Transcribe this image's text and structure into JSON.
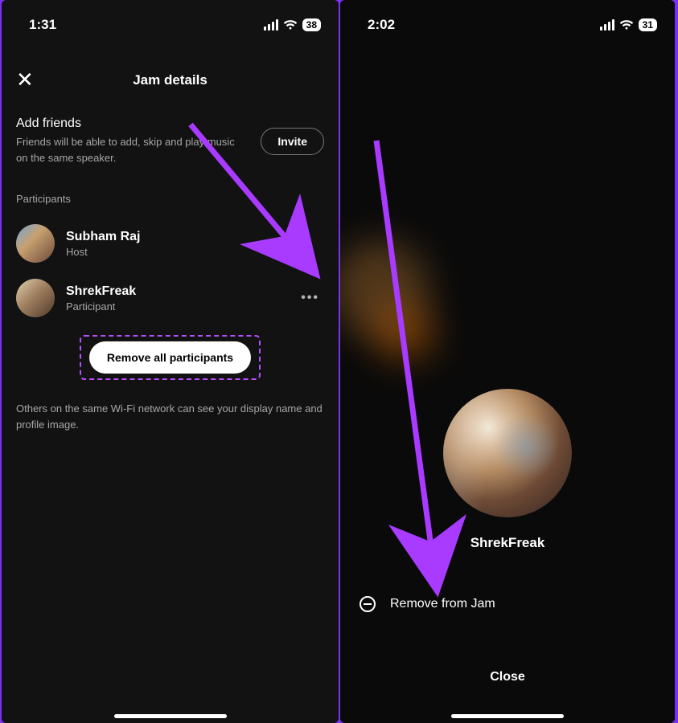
{
  "left": {
    "status": {
      "time": "1:31",
      "battery": "38"
    },
    "nav": {
      "title": "Jam details"
    },
    "add_friends": {
      "title": "Add friends",
      "subtitle": "Friends will be able to add, skip and play music on the same speaker.",
      "invite_label": "Invite"
    },
    "participants_label": "Participants",
    "participants": [
      {
        "name": "Subham Raj",
        "role": "Host"
      },
      {
        "name": "ShrekFreak",
        "role": "Participant"
      }
    ],
    "remove_all_label": "Remove all participants",
    "footer_hint": "Others on the same Wi-Fi network can see your display name and profile image."
  },
  "right": {
    "status": {
      "time": "2:02",
      "battery": "31"
    },
    "profile_name": "ShrekFreak",
    "remove_label": "Remove from Jam",
    "close_label": "Close"
  },
  "colors": {
    "accent_annotation": "#A83BFF"
  }
}
